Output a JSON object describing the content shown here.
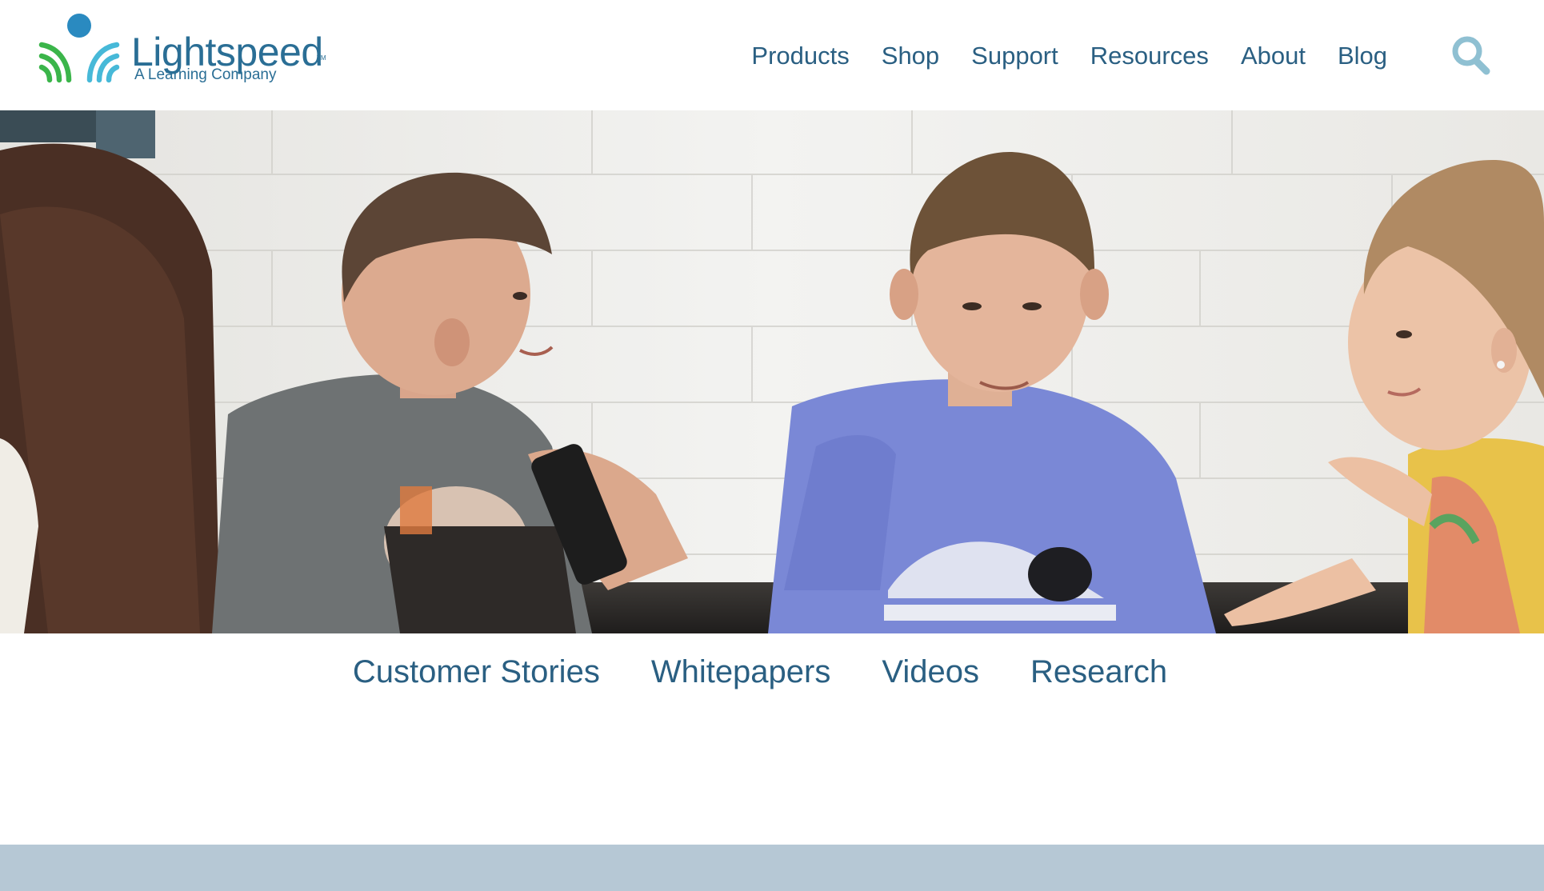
{
  "brand": {
    "name": "Lightspeed",
    "tagline": "A Learning Company",
    "trademark": "TM"
  },
  "nav": {
    "items": [
      {
        "label": "Products"
      },
      {
        "label": "Shop"
      },
      {
        "label": "Support"
      },
      {
        "label": "Resources"
      },
      {
        "label": "About"
      },
      {
        "label": "Blog"
      }
    ],
    "search_icon": "search-icon"
  },
  "hero": {
    "image": "photo of four students talking in a classroom"
  },
  "resources_nav": {
    "items": [
      {
        "label": "Customer Stories"
      },
      {
        "label": "Whitepapers"
      },
      {
        "label": "Videos"
      },
      {
        "label": "Research"
      }
    ]
  },
  "colors": {
    "nav_text": "#2a5f82",
    "logo_text": "#2a6e95",
    "logo_green": "#3bb54a",
    "logo_blue": "#2a8ac0",
    "logo_cyan": "#47b9d8",
    "search_icon": "#8fc0d2",
    "bottom_band": "#b6c8d5"
  }
}
